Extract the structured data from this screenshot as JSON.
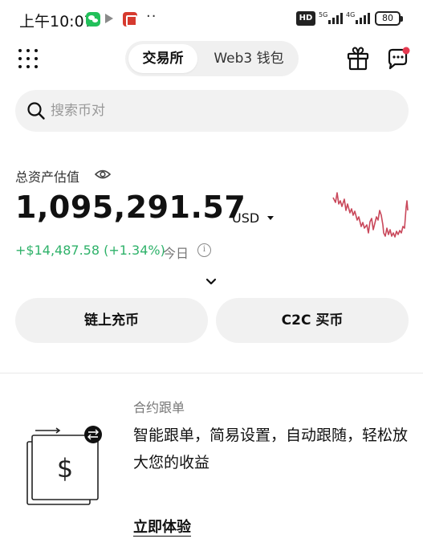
{
  "status_bar": {
    "time": "上午10:07",
    "dots": "··",
    "hd_label": "HD",
    "signal_1_label": "5G",
    "signal_2_label": "4G",
    "battery": "80"
  },
  "header": {
    "tabs": [
      {
        "label": "交易所",
        "active": true
      },
      {
        "label": "Web3 钱包",
        "active": false
      }
    ],
    "notification_dot_color": "#e53950"
  },
  "search": {
    "placeholder": "搜索币对"
  },
  "assets": {
    "label": "总资产估值",
    "value": "1,095,291.57",
    "currency": "USD",
    "today_change": "+$14,487.58 (+1.34%)",
    "today_label": "今日",
    "info_glyph": "i",
    "change_color": "#2fb26a",
    "sparkline_color": "#c9485b"
  },
  "actions": {
    "deposit_label": "链上充币",
    "c2c_label": "C2C 买币"
  },
  "promo": {
    "subtitle": "合约跟单",
    "title": "智能跟单，简易设置，自动跟随，轻松放大您的收益",
    "cta": "立即体验",
    "illustration_glyph": "$"
  }
}
